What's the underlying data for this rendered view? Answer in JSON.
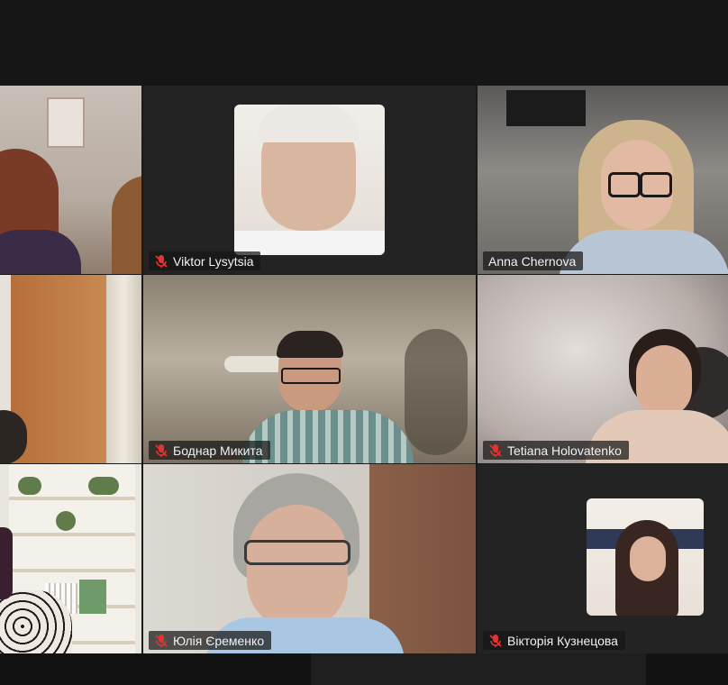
{
  "meeting": {
    "participants": [
      {
        "name": "",
        "muted": false
      },
      {
        "name": "Viktor Lysytsia",
        "muted": true
      },
      {
        "name": "Anna Chernova",
        "muted": false,
        "active_speaker": true
      },
      {
        "name": "",
        "muted": false
      },
      {
        "name": "Боднар Микита",
        "muted": true
      },
      {
        "name": "Tetiana Holovatenko",
        "muted": true
      },
      {
        "name": "",
        "muted": false
      },
      {
        "name": "Юлія Єременко",
        "muted": true
      },
      {
        "name": "Вікторія Кузнецова",
        "muted": true
      }
    ]
  },
  "colors": {
    "active_border": "#2ee07a",
    "muted_icon": "#e0342f",
    "tile_bg": "#262626"
  },
  "icons": {
    "muted": "microphone-muted-icon"
  }
}
